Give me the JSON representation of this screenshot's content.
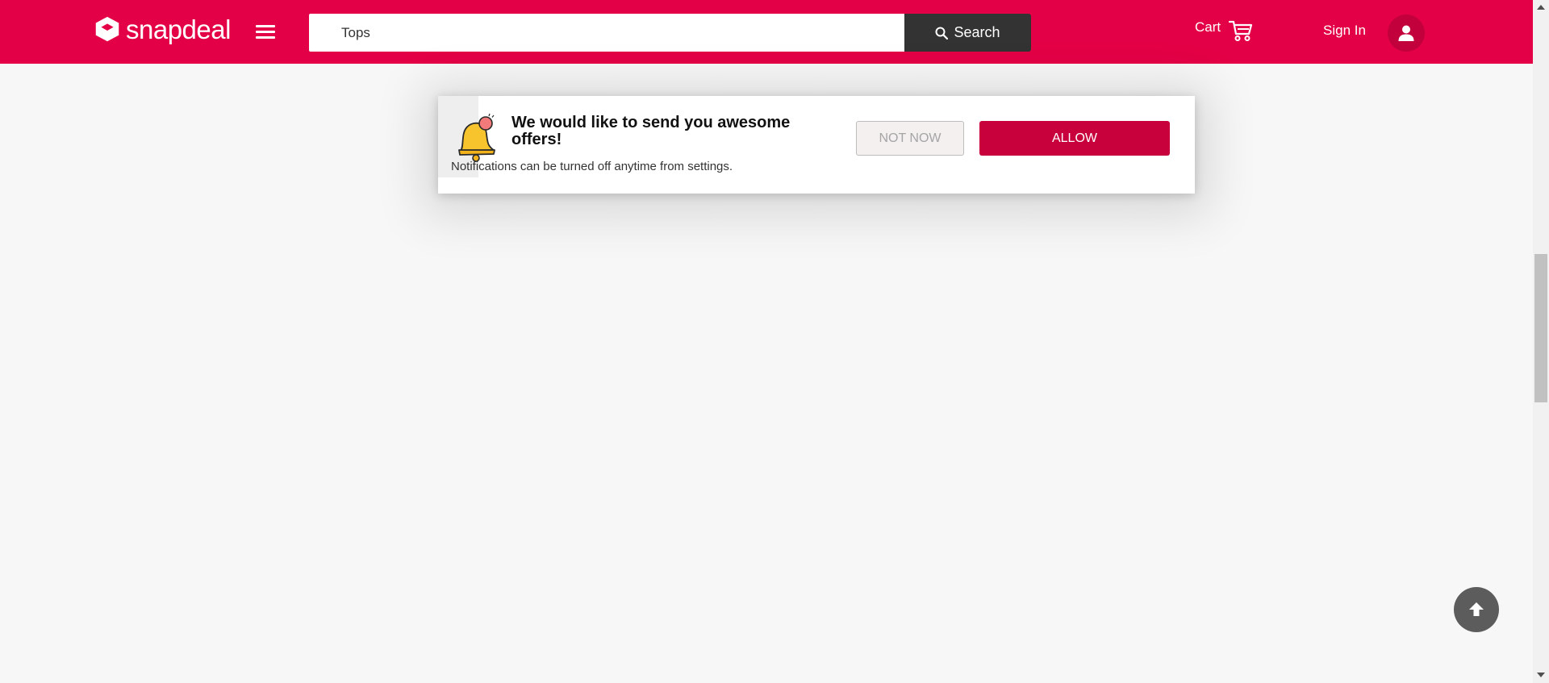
{
  "header": {
    "logo_text": "snapdeal",
    "search_value": "Tops",
    "search_button_label": "Search",
    "cart_label": "Cart",
    "signin_label": "Sign In"
  },
  "notification": {
    "title": "We would like to send you awesome offers!",
    "subtitle": "Notifications can be turned off anytime from settings.",
    "not_now_label": "NOT NOW",
    "allow_label": "ALLOW"
  },
  "colors": {
    "brand": "#e40046",
    "allow_button": "#c8003c",
    "search_button": "#333333",
    "background": "#f7f7f7"
  },
  "icons": {
    "logo": "snapdeal-logo-icon",
    "menu": "hamburger-icon",
    "search": "search-icon",
    "cart": "cart-icon",
    "user": "user-icon",
    "bell": "bell-icon",
    "scroll_top": "arrow-up-icon"
  }
}
